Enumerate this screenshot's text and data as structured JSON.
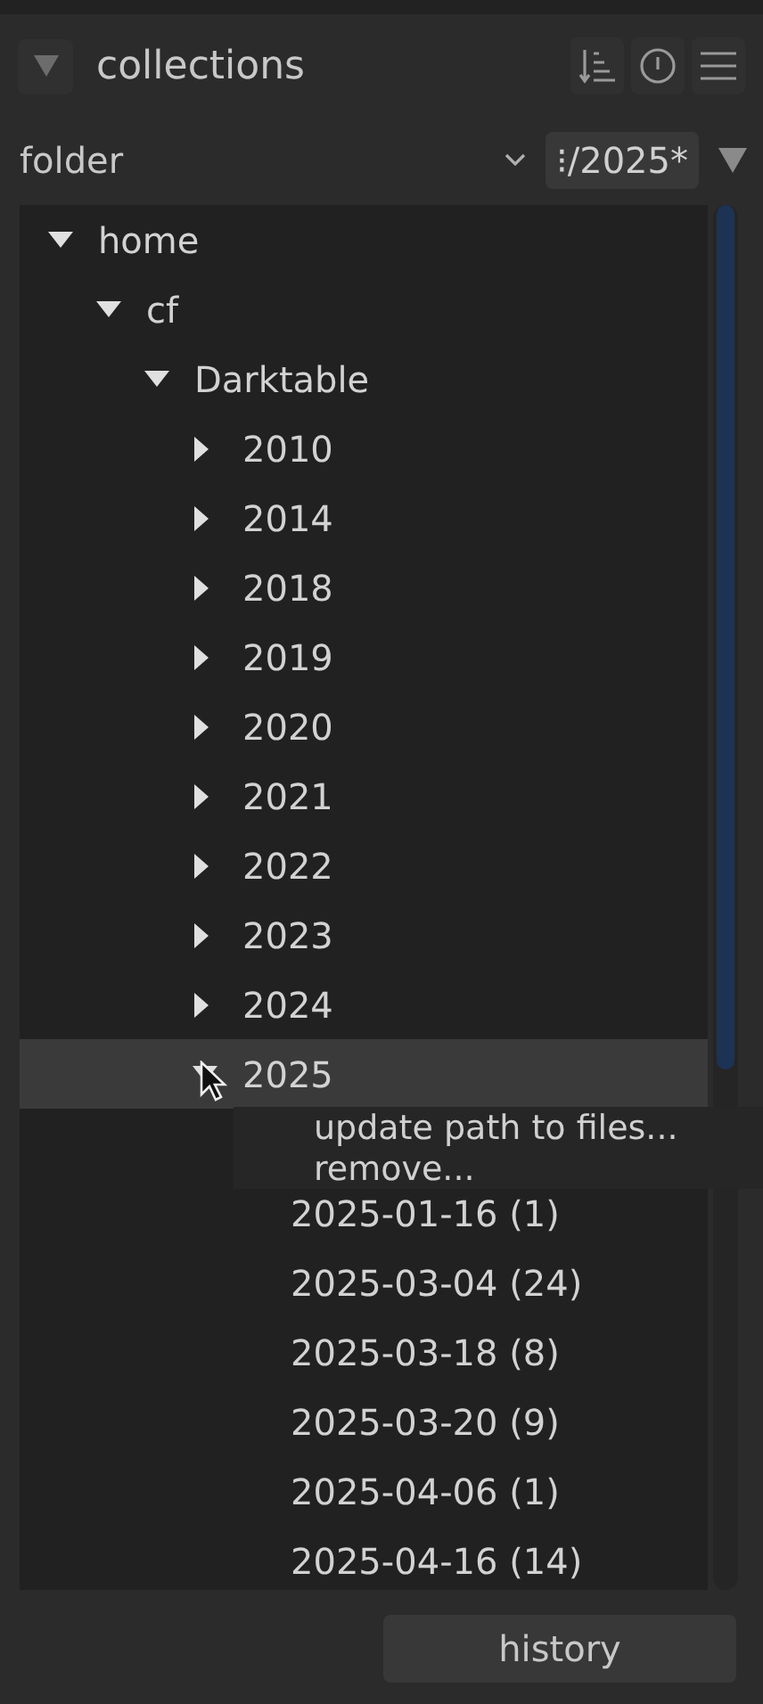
{
  "header": {
    "title": "collections",
    "expanded": true
  },
  "filter": {
    "property": "folder",
    "value": "⁝/2025*"
  },
  "tree": [
    {
      "label": "home",
      "expanded": true,
      "selected": false,
      "children": [
        {
          "label": "cf",
          "expanded": true,
          "selected": false,
          "children": [
            {
              "label": "Darktable",
              "expanded": true,
              "selected": false,
              "children": [
                {
                  "label": "2010",
                  "expanded": false,
                  "selected": false
                },
                {
                  "label": "2014",
                  "expanded": false,
                  "selected": false
                },
                {
                  "label": "2018",
                  "expanded": false,
                  "selected": false
                },
                {
                  "label": "2019",
                  "expanded": false,
                  "selected": false
                },
                {
                  "label": "2020",
                  "expanded": false,
                  "selected": false
                },
                {
                  "label": "2021",
                  "expanded": false,
                  "selected": false
                },
                {
                  "label": "2022",
                  "expanded": false,
                  "selected": false
                },
                {
                  "label": "2023",
                  "expanded": false,
                  "selected": false
                },
                {
                  "label": "2024",
                  "expanded": false,
                  "selected": false
                },
                {
                  "label": "2025",
                  "expanded": true,
                  "selected": true,
                  "children": [
                    {
                      "label": "2025-01-16 (1)",
                      "selected": false
                    },
                    {
                      "label": "2025-03-04 (24)",
                      "selected": false
                    },
                    {
                      "label": "2025-03-18 (8)",
                      "selected": false
                    },
                    {
                      "label": "2025-03-20 (9)",
                      "selected": false
                    },
                    {
                      "label": "2025-04-06 (1)",
                      "selected": false
                    },
                    {
                      "label": "2025-04-16 (14)",
                      "selected": false
                    }
                  ]
                }
              ]
            }
          ]
        }
      ]
    }
  ],
  "context_menu": {
    "items": [
      "update path to files...",
      "remove..."
    ]
  },
  "history_button": "history"
}
